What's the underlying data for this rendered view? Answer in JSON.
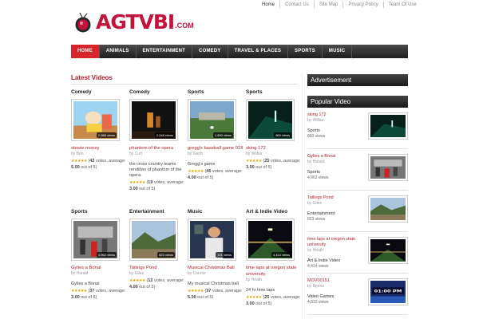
{
  "toplinks": [
    "Home",
    "Contact Us",
    "Site Map",
    "Privacy Policy",
    "Team Of Use"
  ],
  "logo": {
    "text": "AGTVBI",
    "tld": ".COM"
  },
  "nav": [
    "HOME",
    "ANIMALS",
    "ENTERTAINMENT",
    "COMEDY",
    "TRAVEL & PLACES",
    "SPORTS",
    "MUSIC"
  ],
  "latest": {
    "title": "Latest Videos",
    "videos": [
      {
        "category": "Comedy",
        "views": "2,988 views",
        "title": "stewie money",
        "by": "by Ben",
        "desc": "",
        "votes": "42",
        "avg": "5.00",
        "thumb": "cartoon"
      },
      {
        "category": "Comedy",
        "views": "2,048 views",
        "title": "phantom of the opera",
        "by": "by Curt",
        "desc": "the cross country teams rendition of phantom of the opera.",
        "votes": "19",
        "avg": "3.00",
        "thumb": "dark"
      },
      {
        "category": "Sports",
        "views": "1,890 views",
        "title": "gregg's baseball game 018",
        "by": "by Garth",
        "desc": "Gregg's game",
        "votes": "45",
        "avg": "4.00",
        "thumb": "field"
      },
      {
        "category": "Sports",
        "views": "860 views",
        "title": "sking 172",
        "by": "by Wilbur",
        "desc": "",
        "votes": "25",
        "avg": "3.00",
        "thumb": "night"
      },
      {
        "category": "Sports",
        "views": "4,962 views",
        "title": "Gylies a Bonal",
        "by": "by Harald",
        "desc": "Gylies a Bonal",
        "votes": "37",
        "avg": "3.00",
        "thumb": "crowd"
      },
      {
        "category": "Entertainment",
        "views": "823 views",
        "title": "Tailings Pond",
        "by": "by Giles",
        "desc": "",
        "votes": "12",
        "avg": "4.00",
        "thumb": "hills"
      },
      {
        "category": "Music",
        "views": "101 views",
        "title": "Musical Christmas Ball",
        "by": "by Connor",
        "desc": "My musical Christmas ball",
        "votes": "37",
        "avg": "5.00",
        "thumb": "person"
      },
      {
        "category": "Art & Indie Video",
        "views": "4,414 views",
        "title": "time laps at oregon state university",
        "by": "by Heath",
        "desc": "24 hr time laps",
        "votes": "25",
        "avg": "3.00",
        "thumb": "stadium"
      }
    ]
  },
  "sidebar": {
    "advertisement": "Advertisement",
    "popular_title": "Popular Video",
    "items": [
      {
        "title": "sking 172",
        "by": "by Wilbur",
        "category": "Sports",
        "views": "860 views",
        "thumb": "night"
      },
      {
        "title": "Gylies a Bonal",
        "by": "by Harald",
        "category": "Sports",
        "views": "4,962 views",
        "thumb": "crowd"
      },
      {
        "title": "Tailings Pond",
        "by": "by Giles",
        "category": "Entertainment",
        "views": "823 views",
        "thumb": "hills"
      },
      {
        "title": "time laps at oregon state university",
        "by": "by Heath",
        "category": "Art & Indie Video",
        "views": "4,414 views",
        "thumb": "stadium"
      },
      {
        "title": "MOV00151",
        "by": "by Bjorne",
        "category": "Video Games",
        "views": "4,833 views",
        "thumb": "game",
        "overlay": "01:00 PM"
      }
    ]
  },
  "labels": {
    "votes_suffix": "votes,",
    "average": "average:",
    "out_of": "out of 5)"
  },
  "colors": {
    "brand": "#c3133a",
    "nav_active": "#d8242b",
    "link": "#b1202a"
  }
}
